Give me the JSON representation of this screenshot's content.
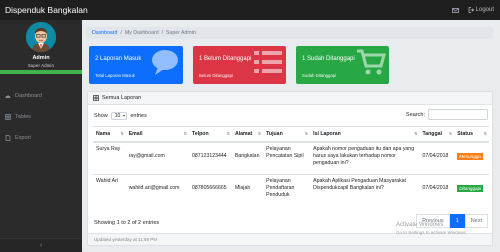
{
  "app": {
    "brand": "Dispenduk Bangkalan",
    "mail_badge": "",
    "logout_label": "Logout"
  },
  "sidebar": {
    "user_name": "Admin",
    "user_role": "Super Admin",
    "items": [
      {
        "label": "Dashboard",
        "icon": "dashboard-icon"
      },
      {
        "label": "Tables",
        "icon": "table-icon"
      },
      {
        "label": "Export",
        "icon": "export-icon"
      }
    ],
    "toggle": "‹"
  },
  "breadcrumb": [
    "Dashboard",
    "My Dashboard",
    "Super Admin"
  ],
  "cards": [
    {
      "title": "2 Laporan Masuk",
      "sub": "Total Laporan Masuk",
      "color": "#0d6efd",
      "icon": "comment-icon"
    },
    {
      "title": "1 Belum Ditanggapi",
      "sub": "Belum Ditanggapi",
      "color": "#dc3545",
      "icon": "list-icon"
    },
    {
      "title": "1 Sudah Ditanggapi",
      "sub": "Sudah Ditanggapi",
      "color": "#28a745",
      "icon": "cart-icon"
    }
  ],
  "panel": {
    "title": "Semua Laporan",
    "show_label": "Show",
    "entries_value": "10",
    "entries_label": "entries",
    "search_label": "Search:",
    "columns": [
      "Nama",
      "Email",
      "Telpon",
      "Alamat",
      "Tujuan",
      "Isi Laporan",
      "Tanggal",
      "Status"
    ],
    "rows": [
      {
        "nama": "Surya Ray",
        "email": "ray@gmail.com",
        "telpon": "087123123444",
        "alamat": "Bangkalan",
        "tujuan": "Pelayanan Pencatatan Sipil",
        "isi": "Apakah nomor pengaduan itu dan apa yang harus saya lakukan terhadap nomor pengaduan ini?",
        "tanggal": "07/04/2018",
        "status": "Menunggu"
      },
      {
        "nama": "Wahid Ari",
        "email": "wahiid.ari@gmail.com",
        "telpon": "087805666665",
        "alamat": "Mlajah",
        "tujuan": "Pelayanan Pendaftaran Penduduk",
        "isi": "Apakah Aplikasi Pengaduan Masyarakat Dispendukcapil Bangkalan ini?",
        "tanggal": "07/04/2018",
        "status": "Ditanggapi"
      }
    ],
    "info": "Showing 1 to 2 of 2 entries",
    "pager": {
      "prev": "Previous",
      "page": "1",
      "next": "Next"
    },
    "footer": "Updated yesterday at 11:59 PM"
  },
  "watermark": {
    "title": "Activate Windows",
    "sub": "Go to Settings to activate Windows."
  },
  "colors": {
    "topbar": "#1e1e1e",
    "sidebar": "#2b2b2b",
    "accent_green": "#3cb54a",
    "warning": "#fd7e14",
    "success": "#28a745"
  }
}
